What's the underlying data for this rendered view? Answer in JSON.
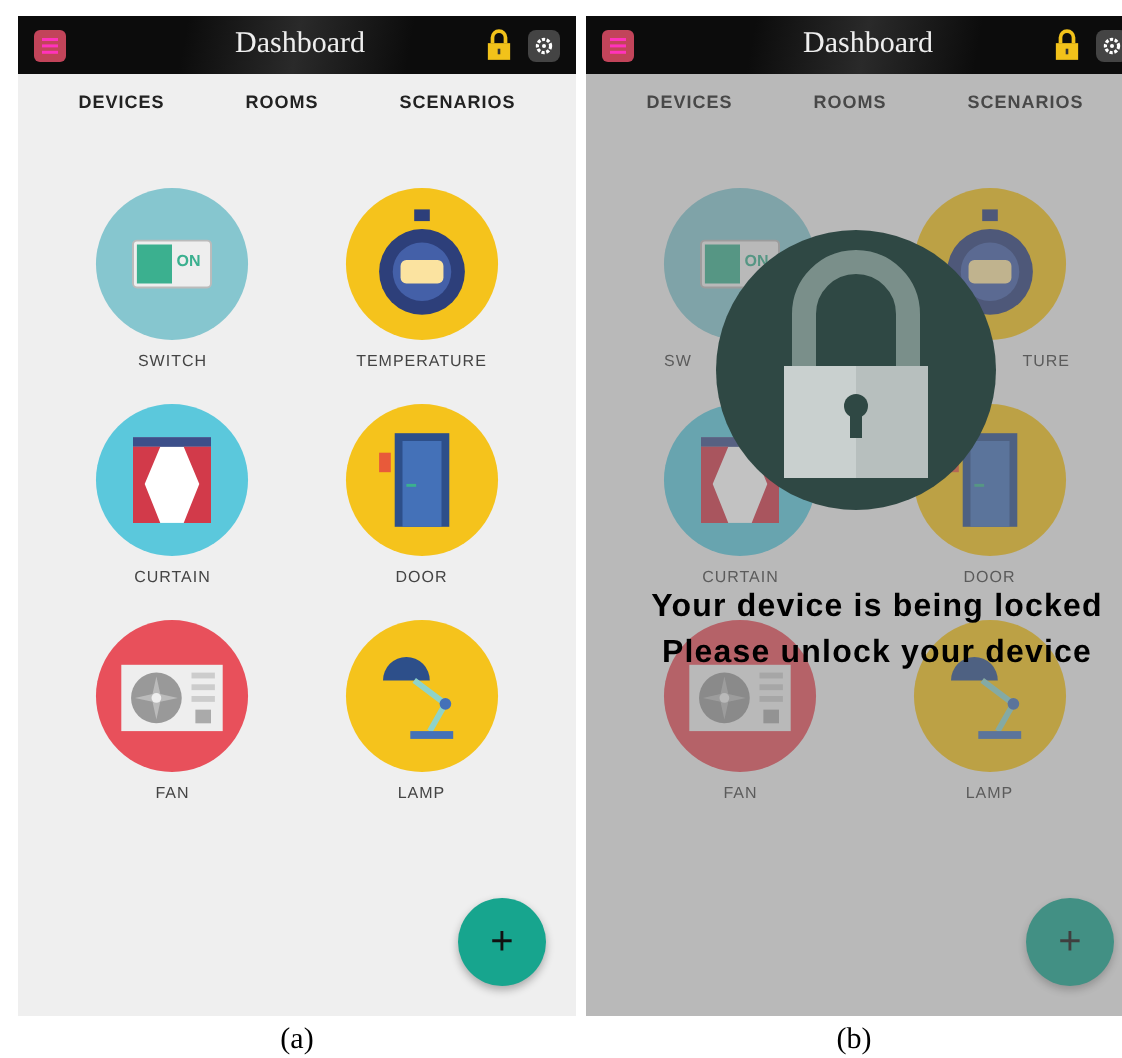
{
  "panels": [
    {
      "caption": "(a)",
      "locked": false,
      "title": "Dashboard",
      "tabs": [
        {
          "label": "DEVICES"
        },
        {
          "label": "ROOMS"
        },
        {
          "label": "SCENARIOS"
        }
      ],
      "devices": [
        {
          "kind": "switch",
          "label": "SWITCH",
          "switch_text": "ON"
        },
        {
          "kind": "timer",
          "label": "TEMPERATURE"
        },
        {
          "kind": "curtain",
          "label": "CURTAIN"
        },
        {
          "kind": "door",
          "label": "DOOR"
        },
        {
          "kind": "fan",
          "label": "FAN"
        },
        {
          "kind": "lamp",
          "label": "LAMP"
        }
      ],
      "fab": "+"
    },
    {
      "caption": "(b)",
      "locked": true,
      "title": "Dashboard",
      "tabs": [
        {
          "label": "DEVICES"
        },
        {
          "label": "ROOMS"
        },
        {
          "label": "SCENARIOS"
        }
      ],
      "devices": [
        {
          "kind": "switch",
          "label": "SW",
          "switch_text": "ON"
        },
        {
          "kind": "timer",
          "label": "TURE"
        },
        {
          "kind": "curtain",
          "label": "CURTAIN"
        },
        {
          "kind": "door",
          "label": "DOOR"
        },
        {
          "kind": "fan",
          "label": "FAN"
        },
        {
          "kind": "lamp",
          "label": "LAMP"
        }
      ],
      "lock_message": [
        "Your device is being locked",
        "Please unlock your device"
      ],
      "fab": "+"
    }
  ]
}
